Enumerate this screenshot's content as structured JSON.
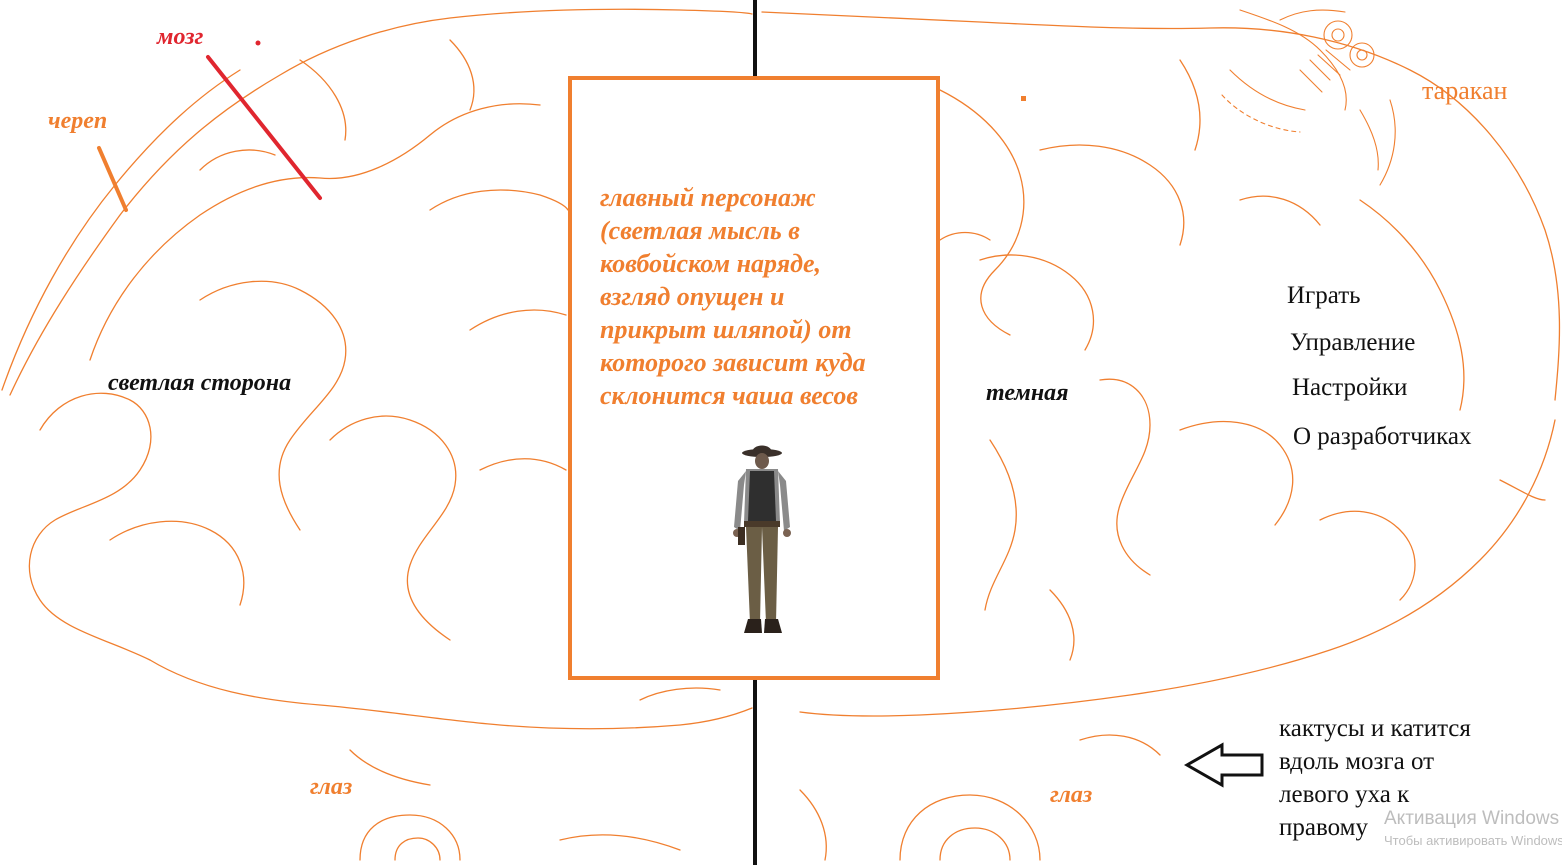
{
  "labels": {
    "brain": "мозг",
    "skull": "череп",
    "light_side": "светлая сторона",
    "dark_side": "темная",
    "cockroach": "таракан",
    "eye_left": "глаз",
    "eye_right": "глаз"
  },
  "character": {
    "description": "главный персонаж\n(светлая мысль в\nковбойском наряде,\nвзгляд опущен и\nприкрыт шляпой) от\nкоторого зависит куда\nсклонится чаша весов"
  },
  "menu": {
    "play": "Играть",
    "controls": "Управление",
    "settings": "Настройки",
    "about": "О разработчиках"
  },
  "note": {
    "text": "кактусы и катится\nвдоль мозга от\nлевого уха к\nправому"
  },
  "watermark": {
    "title": "Активация Windows",
    "subtitle": "Чтобы активировать Windows"
  },
  "colors": {
    "orange": "#f07f2f",
    "red": "#e0262f",
    "black": "#111111",
    "background": "#ffffff"
  }
}
